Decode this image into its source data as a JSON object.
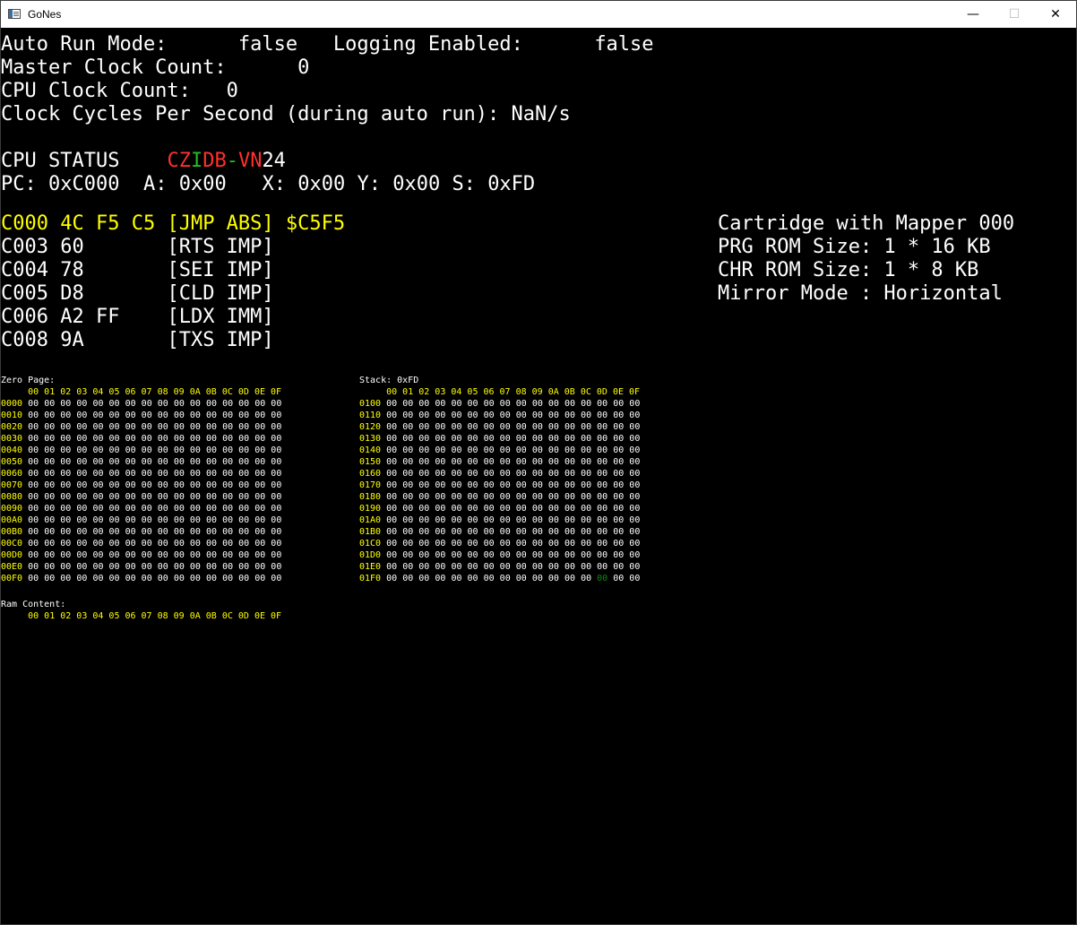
{
  "window": {
    "title": "GoNes",
    "minimize_symbol": "—",
    "maximize_symbol": "☐",
    "close_symbol": "✕"
  },
  "status": {
    "auto_run_label": "Auto Run Mode:",
    "auto_run_value": "false",
    "logging_label": "Logging Enabled:",
    "logging_value": "false",
    "master_clock_label": "Master Clock Count:",
    "master_clock_value": "0",
    "cpu_clock_label": "CPU Clock Count:",
    "cpu_clock_value": "0",
    "cycles_label": "Clock Cycles Per Second (during auto run):",
    "cycles_value": "NaN/s"
  },
  "cpu": {
    "status_label": "CPU STATUS",
    "flags": [
      {
        "char": "C",
        "color": "red"
      },
      {
        "char": "Z",
        "color": "red"
      },
      {
        "char": "I",
        "color": "green"
      },
      {
        "char": "D",
        "color": "red"
      },
      {
        "char": "B",
        "color": "red"
      },
      {
        "char": "-",
        "color": "green"
      },
      {
        "char": "V",
        "color": "red"
      },
      {
        "char": "N",
        "color": "red"
      }
    ],
    "status_value": "24",
    "pc_label": "PC:",
    "pc": "0xC000",
    "a_label": "A:",
    "a": "0x00",
    "x_label": "X:",
    "x": "0x00",
    "y_label": "Y:",
    "y": "0x00",
    "s_label": "S:",
    "s": "0xFD"
  },
  "disassembly": [
    {
      "addr": "C000",
      "bytes": "4C F5 C5",
      "instr": "[JMP ABS]",
      "operand": "$C5F5",
      "current": true
    },
    {
      "addr": "C003",
      "bytes": "60",
      "instr": "[RTS IMP]",
      "operand": "",
      "current": false
    },
    {
      "addr": "C004",
      "bytes": "78",
      "instr": "[SEI IMP]",
      "operand": "",
      "current": false
    },
    {
      "addr": "C005",
      "bytes": "D8",
      "instr": "[CLD IMP]",
      "operand": "",
      "current": false
    },
    {
      "addr": "C006",
      "bytes": "A2 FF",
      "instr": "[LDX IMM]",
      "operand": "",
      "current": false
    },
    {
      "addr": "C008",
      "bytes": "9A",
      "instr": "[TXS IMP]",
      "operand": "",
      "current": false
    }
  ],
  "cartridge": [
    "Cartridge with Mapper 000",
    "PRG ROM Size: 1 * 16 KB",
    "CHR ROM Size: 1 * 8 KB",
    "Mirror Mode : Horizontal"
  ],
  "memory": {
    "column_header": "00 01 02 03 04 05 06 07 08 09 0A 0B 0C 0D 0E 0F",
    "zero_page": {
      "title": "Zero Page:",
      "rows": [
        {
          "addr": "0000",
          "values": "00 00 00 00 00 00 00 00 00 00 00 00 00 00 00 00"
        },
        {
          "addr": "0010",
          "values": "00 00 00 00 00 00 00 00 00 00 00 00 00 00 00 00"
        },
        {
          "addr": "0020",
          "values": "00 00 00 00 00 00 00 00 00 00 00 00 00 00 00 00"
        },
        {
          "addr": "0030",
          "values": "00 00 00 00 00 00 00 00 00 00 00 00 00 00 00 00"
        },
        {
          "addr": "0040",
          "values": "00 00 00 00 00 00 00 00 00 00 00 00 00 00 00 00"
        },
        {
          "addr": "0050",
          "values": "00 00 00 00 00 00 00 00 00 00 00 00 00 00 00 00"
        },
        {
          "addr": "0060",
          "values": "00 00 00 00 00 00 00 00 00 00 00 00 00 00 00 00"
        },
        {
          "addr": "0070",
          "values": "00 00 00 00 00 00 00 00 00 00 00 00 00 00 00 00"
        },
        {
          "addr": "0080",
          "values": "00 00 00 00 00 00 00 00 00 00 00 00 00 00 00 00"
        },
        {
          "addr": "0090",
          "values": "00 00 00 00 00 00 00 00 00 00 00 00 00 00 00 00"
        },
        {
          "addr": "00A0",
          "values": "00 00 00 00 00 00 00 00 00 00 00 00 00 00 00 00"
        },
        {
          "addr": "00B0",
          "values": "00 00 00 00 00 00 00 00 00 00 00 00 00 00 00 00"
        },
        {
          "addr": "00C0",
          "values": "00 00 00 00 00 00 00 00 00 00 00 00 00 00 00 00"
        },
        {
          "addr": "00D0",
          "values": "00 00 00 00 00 00 00 00 00 00 00 00 00 00 00 00"
        },
        {
          "addr": "00E0",
          "values": "00 00 00 00 00 00 00 00 00 00 00 00 00 00 00 00"
        },
        {
          "addr": "00F0",
          "values": "00 00 00 00 00 00 00 00 00 00 00 00 00 00 00 00"
        }
      ]
    },
    "stack": {
      "title": "Stack: 0xFD",
      "rows": [
        {
          "addr": "0100",
          "values": "00 00 00 00 00 00 00 00 00 00 00 00 00 00 00 00"
        },
        {
          "addr": "0110",
          "values": "00 00 00 00 00 00 00 00 00 00 00 00 00 00 00 00"
        },
        {
          "addr": "0120",
          "values": "00 00 00 00 00 00 00 00 00 00 00 00 00 00 00 00"
        },
        {
          "addr": "0130",
          "values": "00 00 00 00 00 00 00 00 00 00 00 00 00 00 00 00"
        },
        {
          "addr": "0140",
          "values": "00 00 00 00 00 00 00 00 00 00 00 00 00 00 00 00"
        },
        {
          "addr": "0150",
          "values": "00 00 00 00 00 00 00 00 00 00 00 00 00 00 00 00"
        },
        {
          "addr": "0160",
          "values": "00 00 00 00 00 00 00 00 00 00 00 00 00 00 00 00"
        },
        {
          "addr": "0170",
          "values": "00 00 00 00 00 00 00 00 00 00 00 00 00 00 00 00"
        },
        {
          "addr": "0180",
          "values": "00 00 00 00 00 00 00 00 00 00 00 00 00 00 00 00"
        },
        {
          "addr": "0190",
          "values": "00 00 00 00 00 00 00 00 00 00 00 00 00 00 00 00"
        },
        {
          "addr": "01A0",
          "values": "00 00 00 00 00 00 00 00 00 00 00 00 00 00 00 00"
        },
        {
          "addr": "01B0",
          "values": "00 00 00 00 00 00 00 00 00 00 00 00 00 00 00 00"
        },
        {
          "addr": "01C0",
          "values": "00 00 00 00 00 00 00 00 00 00 00 00 00 00 00 00"
        },
        {
          "addr": "01D0",
          "values": "00 00 00 00 00 00 00 00 00 00 00 00 00 00 00 00"
        },
        {
          "addr": "01E0",
          "values": "00 00 00 00 00 00 00 00 00 00 00 00 00 00 00 00"
        },
        {
          "addr": "01F0",
          "values": "00 00 00 00 00 00 00 00 00 00 00 00 00 00 00 00"
        }
      ],
      "pointer_row": 15,
      "pointer_col": 13
    },
    "ram": {
      "title": "Ram Content:"
    }
  },
  "colors": {
    "highlight": "#ffff00",
    "flag_set": "#22bb22",
    "flag_clear": "#ff3030",
    "stack_pointer": "#118811",
    "text": "#ffffff",
    "background": "#000000"
  }
}
